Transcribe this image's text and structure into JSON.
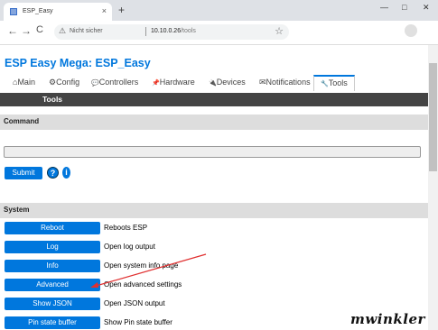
{
  "browser": {
    "tab_title": "ESP_Easy",
    "tab_close": "×",
    "new_tab": "+",
    "minimize": "—",
    "maximize": "□",
    "close": "✕",
    "back": "←",
    "forward": "→",
    "reload": "C",
    "security_label": "Nicht sicher",
    "url_host": "10.10.0.26",
    "url_path": "/tools",
    "bookmark": "☆"
  },
  "page": {
    "title": "ESP Easy Mega: ESP_Easy",
    "menu": [
      {
        "icon": "⌂",
        "label": "Main"
      },
      {
        "icon": "⚙",
        "label": "Config"
      },
      {
        "icon": "💬",
        "label": "Controllers"
      },
      {
        "icon": "📌",
        "label": "Hardware"
      },
      {
        "icon": "🔌",
        "label": "Devices"
      },
      {
        "icon": "✉",
        "label": "Notifications"
      },
      {
        "icon": "🔧",
        "label": "Tools"
      }
    ],
    "active_menu": "Tools",
    "subbar_label": "Tools",
    "command_section": "Command",
    "command_value": "",
    "submit_label": "Submit",
    "help_label": "?",
    "info_label": "i",
    "system_section": "System",
    "tools": [
      {
        "button": "Reboot",
        "description": "Reboots ESP"
      },
      {
        "button": "Log",
        "description": "Open log output"
      },
      {
        "button": "Info",
        "description": "Open system info page"
      },
      {
        "button": "Advanced",
        "description": "Open advanced settings"
      },
      {
        "button": "Show JSON",
        "description": "Open JSON output"
      },
      {
        "button": "Pin state buffer",
        "description": "Show Pin state buffer"
      }
    ]
  },
  "annotation": {
    "signature": "mwinkler",
    "arrow_color": "#e03030"
  },
  "colors": {
    "accent": "#0077dd",
    "dark_bar": "#444444",
    "section_bg": "#dddddd"
  }
}
